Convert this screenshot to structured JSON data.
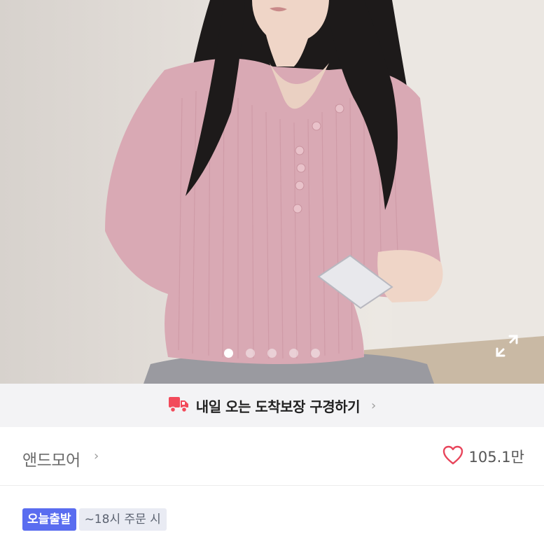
{
  "product_image": {
    "carousel": {
      "total": 5,
      "active_index": 0
    },
    "expand_icon": "expand-icon"
  },
  "delivery_banner": {
    "icon": "delivery-truck-icon",
    "text": "내일 오는 도착보장 구경하기",
    "chevron": "›",
    "icon_color": "#f24a5a"
  },
  "shop": {
    "name": "앤드모어",
    "chevron": "›",
    "like_icon": "heart-icon",
    "like_count": "105.1만",
    "heart_color": "#e8455b"
  },
  "badges": {
    "shipping": "오늘출발",
    "cutoff": "~18시 주문 시",
    "accent": "#5a6df0"
  }
}
